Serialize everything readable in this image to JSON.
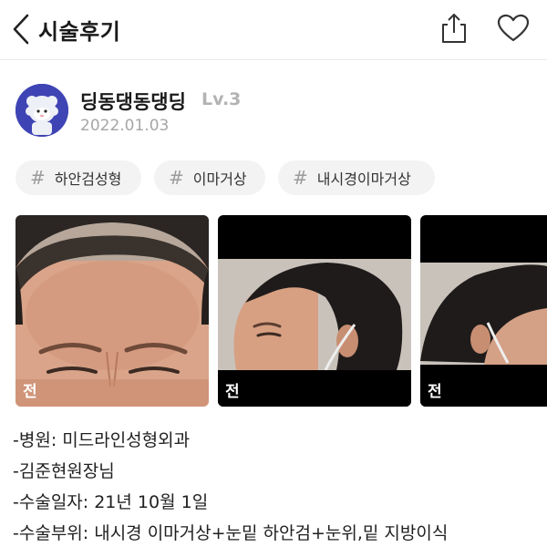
{
  "header": {
    "title": "시술후기",
    "back_icon": "chevron-left-icon",
    "share_icon": "share-icon",
    "like_icon": "heart-icon"
  },
  "author": {
    "name": "딩동댕동댕딩",
    "level": "Lv.3",
    "date": "2022.01.03",
    "avatar_icon": "cartoon-sheep-avatar",
    "avatar_color": "#3f44b4"
  },
  "tags": [
    {
      "hash": "#",
      "label": "하안검성형"
    },
    {
      "hash": "#",
      "label": "이마거상"
    },
    {
      "hash": "#",
      "label": "내시경이마거상"
    }
  ],
  "photos": [
    {
      "label": "전"
    },
    {
      "label": "전"
    },
    {
      "label": "전"
    }
  ],
  "details": [
    "-병원: 미드라인성형외과",
    "-김준현원장님",
    "-수술일자: 21년 10월 1일",
    "-수술부위: 내시경 이마거상+눈밑 하안검+눈위,밑 지방이식"
  ]
}
